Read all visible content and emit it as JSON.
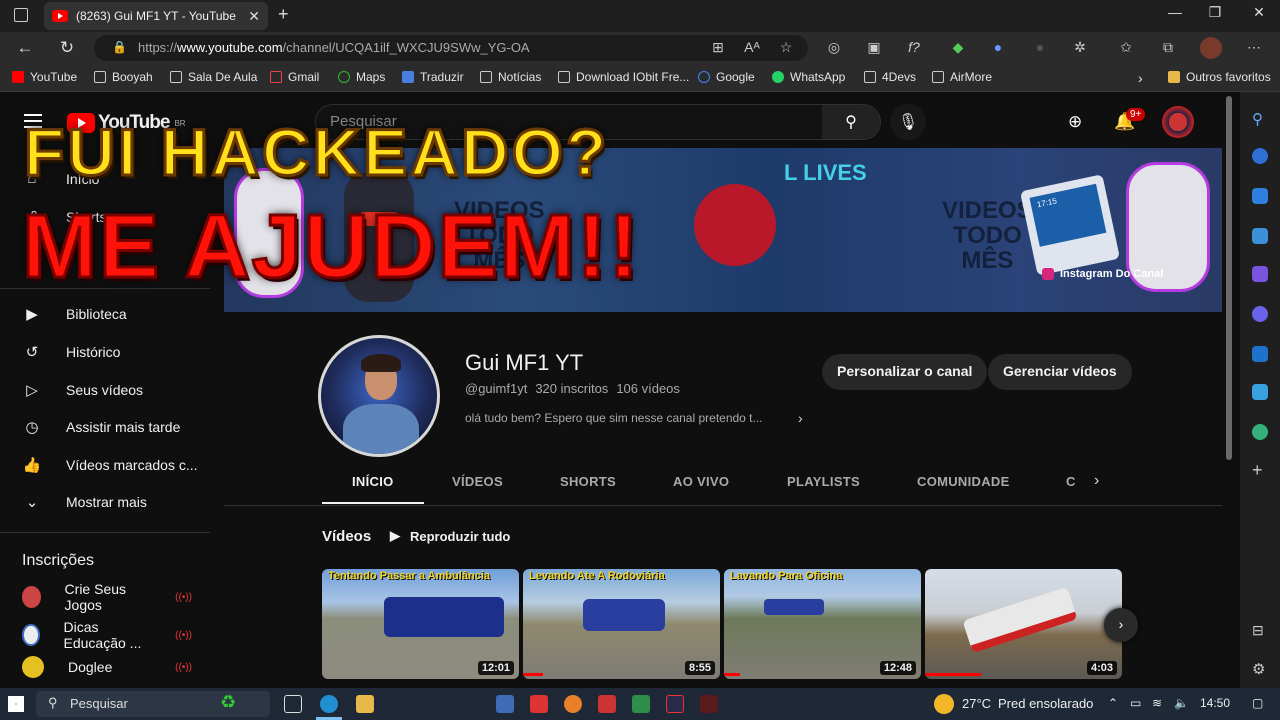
{
  "browser": {
    "tab_title": "(8263) Gui MF1 YT - YouTube",
    "tab_close": "✕",
    "url_prefix": "https://",
    "url_host": "www.youtube.com",
    "url_path": "/channel/UCQA1ilf_WXCJU9SWw_YG-OA",
    "bookmarks": [
      "YouTube",
      "Booyah",
      "Sala De Aula",
      "Gmail",
      "Maps",
      "Traduzir",
      "Notícias",
      "Download IObit Fre...",
      "Google",
      "WhatsApp",
      "4Devs",
      "AirMore"
    ],
    "other_favorites": "Outros favoritos",
    "chevron": "›"
  },
  "youtube": {
    "logo": "YouTube",
    "region": "BR",
    "search_placeholder": "Pesquisar",
    "notif_count": "9+",
    "nav": {
      "top": [
        "Início",
        "Shorts"
      ],
      "library": [
        "Biblioteca",
        "Histórico",
        "Seus vídeos",
        "Assistir mais tarde",
        "Vídeos marcados c...",
        "Mostrar mais"
      ],
      "subs_heading": "Inscrições",
      "subs": [
        "Crie Seus Jogos",
        "Dicas Educação ...",
        "Doglee"
      ]
    },
    "banner": {
      "lives": "L LIVES",
      "left_text": "VIDEOS\nTODO\nMÊS",
      "right_text": "VIDEOS\nTODO\nMÊS",
      "instagram": "Instagram Do Canal",
      "screen_time": "17:15"
    },
    "channel": {
      "name": "Gui MF1 YT",
      "handle": "@guimf1yt",
      "subscribers": "320 inscritos",
      "video_count": "106 vídeos",
      "description": "olá tudo bem? Espero que sim nesse canal pretendo t...",
      "customize": "Personalizar o canal",
      "manage": "Gerenciar vídeos"
    },
    "tabs": [
      "INÍCIO",
      "VÍDEOS",
      "SHORTS",
      "AO VIVO",
      "PLAYLISTS",
      "COMUNIDADE",
      "C"
    ],
    "videos_heading": "Vídeos",
    "play_all": "Reproduzir tudo",
    "videos": [
      {
        "overlay": "Tentando Passar a Ambulância",
        "duration": "12:01"
      },
      {
        "overlay": "Levando Ate A Rodoviária",
        "duration": "8:55"
      },
      {
        "overlay": "Lavando Para Oficina",
        "duration": "12:48"
      },
      {
        "overlay": "",
        "duration": "4:03"
      }
    ]
  },
  "overlay": {
    "line1": "FUI HACKEADO?",
    "line2": "ME AJUDEM!!"
  },
  "taskbar": {
    "search": "Pesquisar",
    "temp": "27°C",
    "weather": "Pred ensolarado",
    "time": "14:50"
  },
  "colors": {
    "yt_red": "#ff0000",
    "overlay_yellow": "#ffe01a",
    "overlay_red": "#ff1208"
  }
}
